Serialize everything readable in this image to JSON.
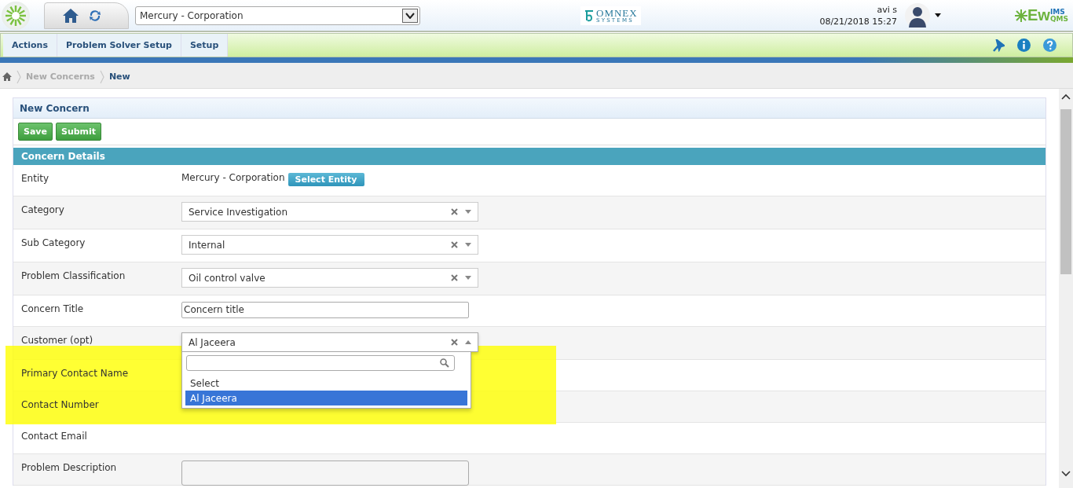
{
  "header": {
    "entity_select": {
      "value": "Mercury - Corporation"
    },
    "brand": {
      "name": "OMNEX",
      "tagline": "S Y S T E M S"
    },
    "user": {
      "name": "avi s",
      "datetime": "08/21/2018 15:27"
    },
    "product": {
      "name": "Ew",
      "super": "IMS",
      "sub": "QMS"
    }
  },
  "menu": [
    {
      "label": "Actions"
    },
    {
      "label": "Problem Solver Setup"
    },
    {
      "label": "Setup"
    }
  ],
  "breadcrumb": [
    {
      "label": "New Concerns",
      "current": false
    },
    {
      "label": "New",
      "current": true
    }
  ],
  "panel": {
    "title": "New Concern",
    "buttons": [
      "Save",
      "Submit"
    ],
    "section": "Concern Details"
  },
  "fields": [
    {
      "label": "Entity",
      "kind": "text",
      "value": "Mercury - Corporation",
      "button": "Select Entity"
    },
    {
      "label": "Category",
      "kind": "select",
      "value": "Service Investigation",
      "expanded": false
    },
    {
      "label": "Sub Category",
      "kind": "select",
      "value": "Internal",
      "expanded": false
    },
    {
      "label": "Problem Classification",
      "kind": "select",
      "value": "Oil control valve",
      "expanded": false
    },
    {
      "label": "Concern Title",
      "kind": "input",
      "value": "Concern title"
    },
    {
      "label": "Customer (opt)",
      "kind": "select",
      "value": "Al Jaceera",
      "expanded": true,
      "options": [
        {
          "label": "Select",
          "selected": false
        },
        {
          "label": "Al Jaceera",
          "selected": true
        }
      ]
    },
    {
      "label": "Primary Contact Name",
      "kind": "none"
    },
    {
      "label": "Contact Number",
      "kind": "none"
    },
    {
      "label": "Contact Email",
      "kind": "none"
    },
    {
      "label": "Problem Description",
      "kind": "textarea"
    }
  ]
}
